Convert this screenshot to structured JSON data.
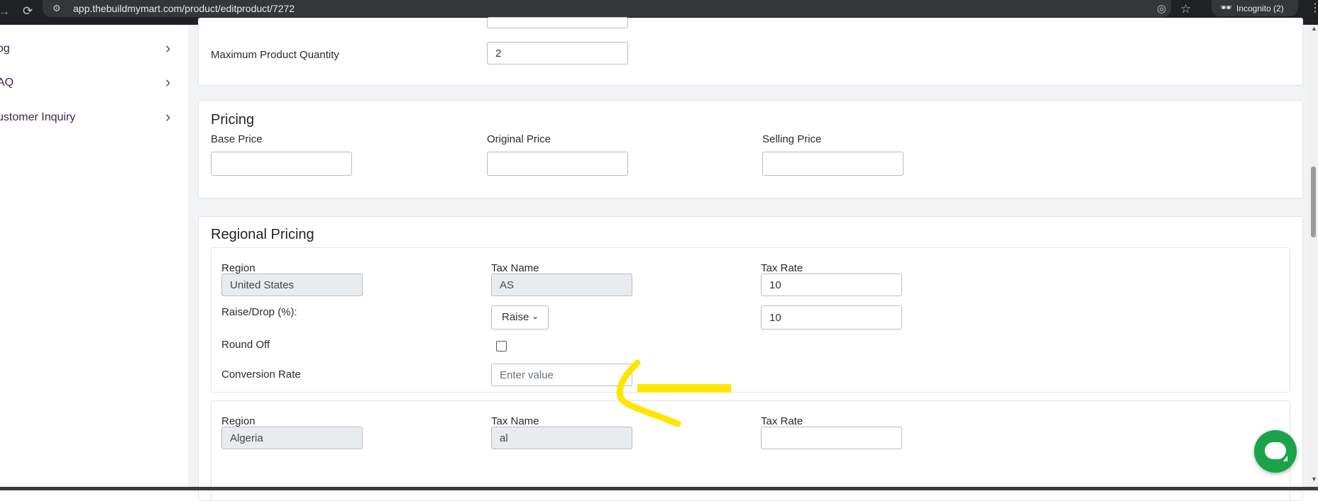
{
  "browser": {
    "url": "app.thebuildmymart.com/product/editproduct/7272",
    "incognito_label": "Incognito (2)"
  },
  "sidebar": {
    "items": [
      {
        "label": "og"
      },
      {
        "label": "AQ"
      },
      {
        "label": "ustomer Inquiry"
      }
    ]
  },
  "quantity": {
    "max_label": "Maximum Product Quantity",
    "max_value": "2"
  },
  "pricing": {
    "title": "Pricing",
    "base_label": "Base Price",
    "original_label": "Original Price",
    "selling_label": "Selling Price",
    "base_value": "",
    "original_value": "",
    "selling_value": ""
  },
  "regional": {
    "title": "Regional Pricing",
    "blocks": [
      {
        "region_label": "Region",
        "region_value": "United States",
        "tax_name_label": "Tax Name",
        "tax_name_value": "AS",
        "tax_rate_label": "Tax Rate",
        "tax_rate_value": "10",
        "raise_drop_label": "Raise/Drop (%):",
        "raise_drop_option": "Raise",
        "raise_drop_value": "10",
        "round_off_label": "Round Off",
        "round_off_checked": false,
        "conversion_label": "Conversion Rate",
        "conversion_placeholder": "Enter value"
      },
      {
        "region_label": "Region",
        "region_value": "Algeria",
        "tax_name_label": "Tax Name",
        "tax_name_value": "al",
        "tax_rate_label": "Tax Rate",
        "tax_rate_value": ""
      }
    ]
  },
  "colors": {
    "chat_button": "#1aa34a",
    "annotation": "#ffe600",
    "sidebar_text": "#3b2450"
  },
  "icons": [
    "back-arrow-icon",
    "reload-icon",
    "site-info-icon",
    "eye-off-icon",
    "star-icon",
    "incognito-icon",
    "kebab-menu-icon",
    "chevron-right-icon",
    "chat-icon"
  ]
}
